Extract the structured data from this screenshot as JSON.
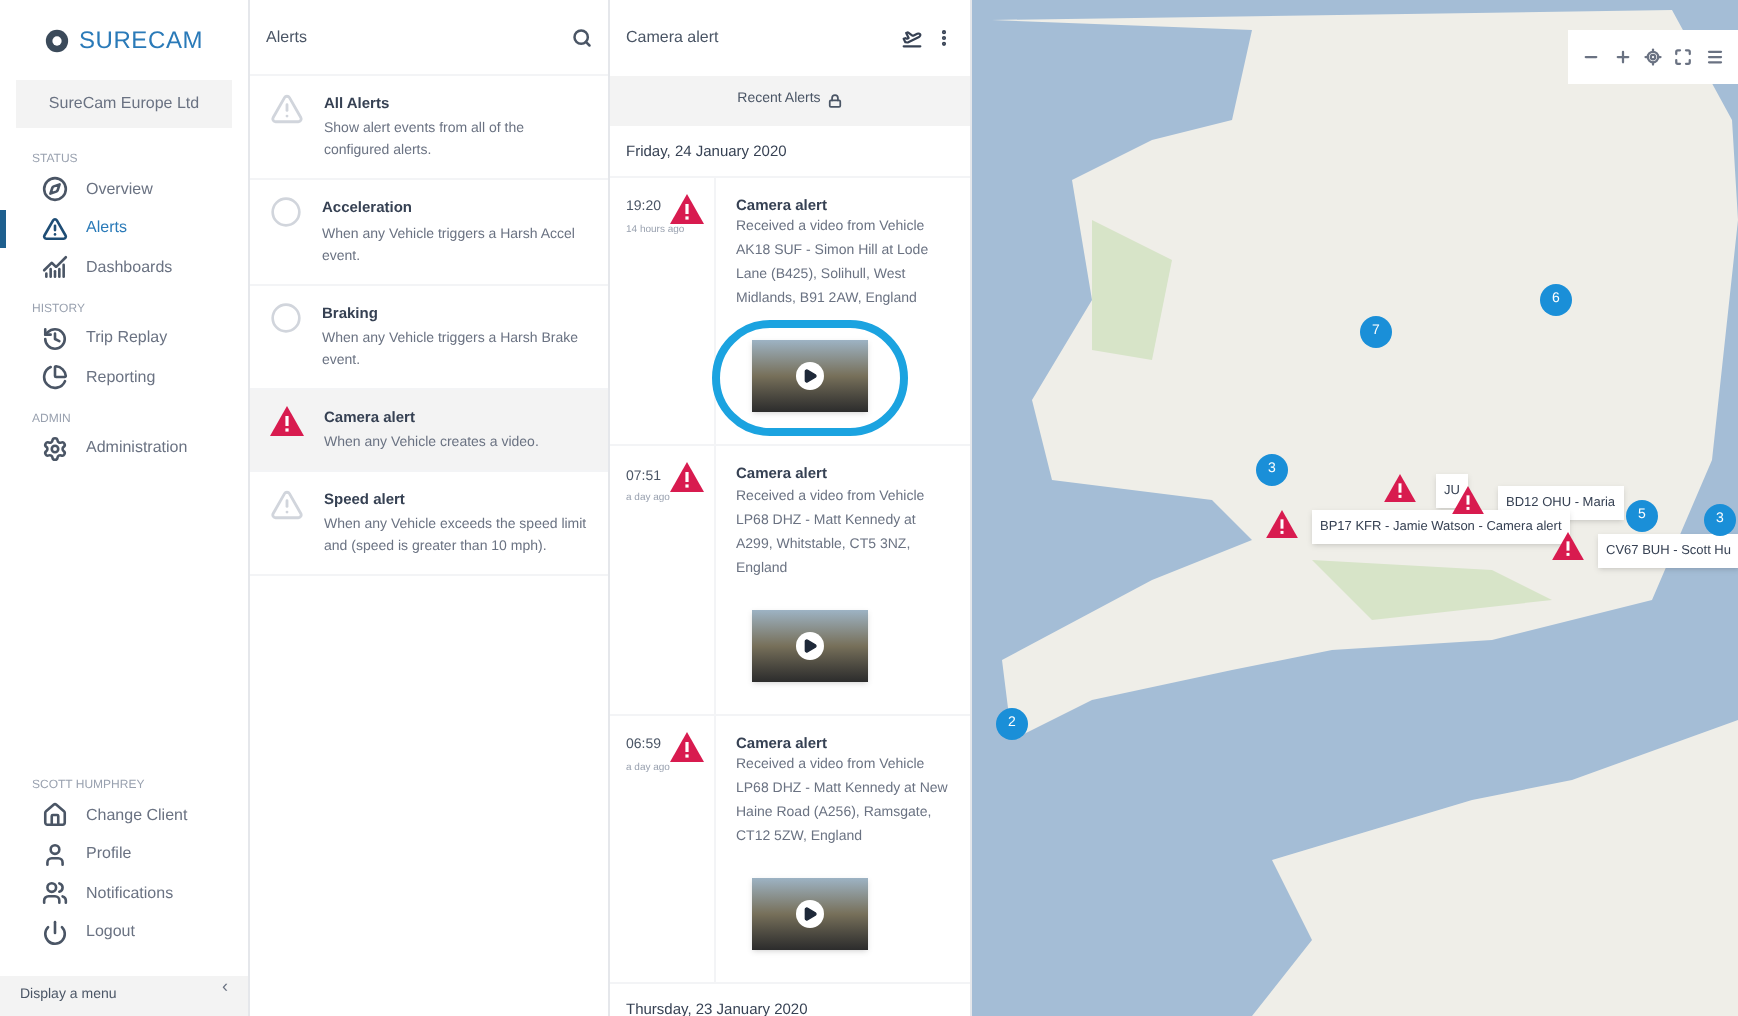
{
  "sidebar": {
    "logo_text": "SURECAM",
    "client": "SureCam Europe Ltd",
    "sections": [
      {
        "heading": "STATUS",
        "items": [
          {
            "label": "Overview",
            "selected": false
          },
          {
            "label": "Alerts",
            "selected": true
          },
          {
            "label": "Dashboards",
            "selected": false
          }
        ]
      },
      {
        "heading": "HISTORY",
        "items": [
          {
            "label": "Trip Replay",
            "selected": false
          },
          {
            "label": "Reporting",
            "selected": false
          }
        ]
      },
      {
        "heading": "ADMIN",
        "items": [
          {
            "label": "Administration",
            "selected": false
          }
        ]
      }
    ],
    "user": {
      "heading": "SCOTT HUMPHREY",
      "items": [
        {
          "label": "Change Client"
        },
        {
          "label": "Profile"
        },
        {
          "label": "Notifications"
        },
        {
          "label": "Logout"
        }
      ]
    },
    "footer": "Display a menu",
    "collapse": "‹"
  },
  "alerts_panel": {
    "title": "Alerts",
    "items": [
      {
        "title": "All Alerts",
        "description": "Show alert events from all of the configured alerts.",
        "kind": "triangle",
        "selected": false
      },
      {
        "title": "Acceleration",
        "description": "When any Vehicle triggers a Harsh Accel event.",
        "kind": "circle",
        "selected": false
      },
      {
        "title": "Braking",
        "description": "When any Vehicle triggers a Harsh Brake event.",
        "kind": "circle",
        "selected": false
      },
      {
        "title": "Camera alert",
        "description": "When any Vehicle creates a video.",
        "kind": "triangle",
        "selected": true
      },
      {
        "title": "Speed alert",
        "description": "When any Vehicle exceeds the speed limit and (speed is greater than 10 mph).",
        "kind": "triangle",
        "selected": false
      }
    ]
  },
  "camera_panel": {
    "title": "Camera alert",
    "recent": "Recent Alerts",
    "days": [
      {
        "date": "Friday, 24 January 2020",
        "alerts": [
          {
            "time": "19:20",
            "ago": "14 hours ago",
            "title": "Camera alert",
            "text": "Received a video from Vehicle AK18 SUF - Simon Hill at Lode Lane (B425), Solihull, West Midlands, B91 2AW, England",
            "highlighted": true
          },
          {
            "time": "07:51",
            "ago": "a day ago",
            "title": "Camera alert",
            "text": "Received a video from Vehicle LP68 DHZ - Matt Kennedy at A299, Whitstable, CT5 3NZ, England",
            "highlighted": false
          },
          {
            "time": "06:59",
            "ago": "a day ago",
            "title": "Camera alert",
            "text": "Received a video from Vehicle LP68 DHZ - Matt Kennedy at New Haine Road (A256), Ramsgate, CT12 5ZW, England",
            "highlighted": false
          }
        ]
      },
      {
        "date": "Thursday, 23 January 2020"
      }
    ]
  },
  "map": {
    "clusters": [
      {
        "count": "7"
      },
      {
        "count": "6"
      },
      {
        "count": "3"
      },
      {
        "count": "2"
      },
      {
        "count": "5"
      },
      {
        "count": "3"
      }
    ],
    "popups": [
      {
        "text": "JU"
      },
      {
        "text": "BD12 OHU - Maria"
      },
      {
        "text": "BP17 KFR - Jamie Watson - Camera alert"
      },
      {
        "text": "CV67 BUH - Scott Hu"
      }
    ]
  }
}
